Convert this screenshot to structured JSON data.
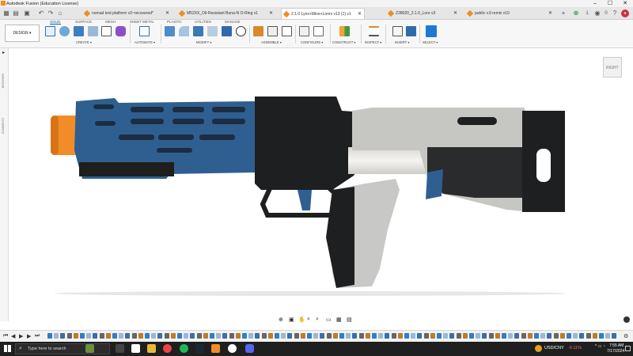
{
  "window": {
    "title": "Autodesk Fusion (Education License)",
    "controls": [
      "–",
      "☐",
      "✕"
    ]
  },
  "tabs": [
    {
      "label": "nomad test platform v3~recovered*",
      "active": false
    },
    {
      "label": "M52XX_Oil-Resistant Buna-N O-Ring v1",
      "active": false
    },
    {
      "label": "2.1.0 Lynx+Mine+Lorev v13 (1) v1",
      "active": true
    },
    {
      "label": "Z38020_2.1.0_Lore v3",
      "active": false
    },
    {
      "label": "public v.9 remix v10",
      "active": false
    }
  ],
  "tabbar_right": {
    "count": "1",
    "badge": "0"
  },
  "ribbon": {
    "workspace": "DESIGN ▾",
    "tabs": [
      "SOLID",
      "SURFACE",
      "MESH",
      "SHEET METAL",
      "PLASTIC",
      "UTILITIES",
      "MANAGE"
    ],
    "active_tab": "SOLID",
    "groups": [
      "CREATE ▾",
      "AUTOMATE ▾",
      "MODIFY ▾",
      "ASSEMBLE ▾",
      "CONFIGURE ▾",
      "CONSTRUCT ▾",
      "INSPECT ▾",
      "INSERT ▾",
      "SELECT ▾"
    ]
  },
  "left_panel": {
    "browser": "BROWSER",
    "comments": "COMMENTS"
  },
  "viewcube": {
    "face": "RIGHT"
  },
  "taskbar": {
    "search_placeholder": "Type here to search",
    "ticker": "USD/CNY",
    "change": "-0.11%",
    "time": "7:55 AM",
    "date": "7/17/2024"
  },
  "colors": {
    "accent": "#0696d7",
    "orange": "#f28c28",
    "blue": "#2f5f90"
  }
}
